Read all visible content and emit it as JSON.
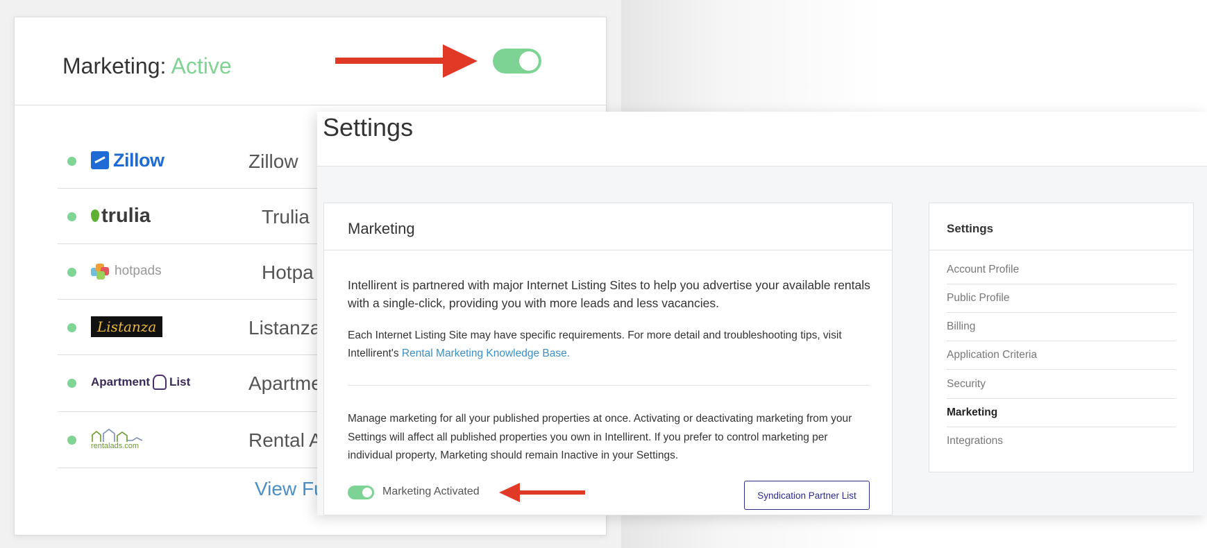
{
  "marketing_card": {
    "title_prefix": "Marketing:",
    "status": "Active",
    "status_color": "#7fd393",
    "toggle_on": true,
    "arrow_color": "#e03a26",
    "sites": [
      {
        "logo_text": "Zillow",
        "name": "Zillow"
      },
      {
        "logo_text": "trulia",
        "name": "Trulia"
      },
      {
        "logo_text": "hotpads",
        "name": "Hotpa"
      },
      {
        "logo_text": "Listanza",
        "name": "Listanza"
      },
      {
        "logo_text": "Apartment",
        "logo_text_2": "List",
        "name": "Apartme"
      },
      {
        "logo_text": "rentalads.com",
        "name": "Rental A"
      }
    ],
    "view_full": "View Fu"
  },
  "settings_window": {
    "title": "Settings",
    "main": {
      "title": "Marketing",
      "intro": "Intellirent is partnered with major Internet Listing Sites to help you advertise your available rentals with a single-click, providing you with more leads and less vacancies.",
      "detail_text": "Each Internet Listing Site may have specific requirements. For more detail and troubleshooting tips, visit Intellirent's",
      "kb_link": "Rental Marketing Knowledge Base.",
      "manage_text": "Manage marketing for all your published properties at once. Activating or deactivating marketing from your Settings will affect all published properties you own in Intellirent. If you prefer to control marketing per individual property, Marketing should remain Inactive in your Settings.",
      "toggle_label": "Marketing Activated",
      "toggle_on": true,
      "partner_button": "Syndication Partner List"
    },
    "sidebar": {
      "title": "Settings",
      "items": [
        {
          "label": "Account Profile"
        },
        {
          "label": "Public Profile"
        },
        {
          "label": "Billing"
        },
        {
          "label": "Application Criteria"
        },
        {
          "label": "Security"
        },
        {
          "label": "Marketing",
          "active": true
        },
        {
          "label": "Integrations"
        }
      ]
    }
  }
}
